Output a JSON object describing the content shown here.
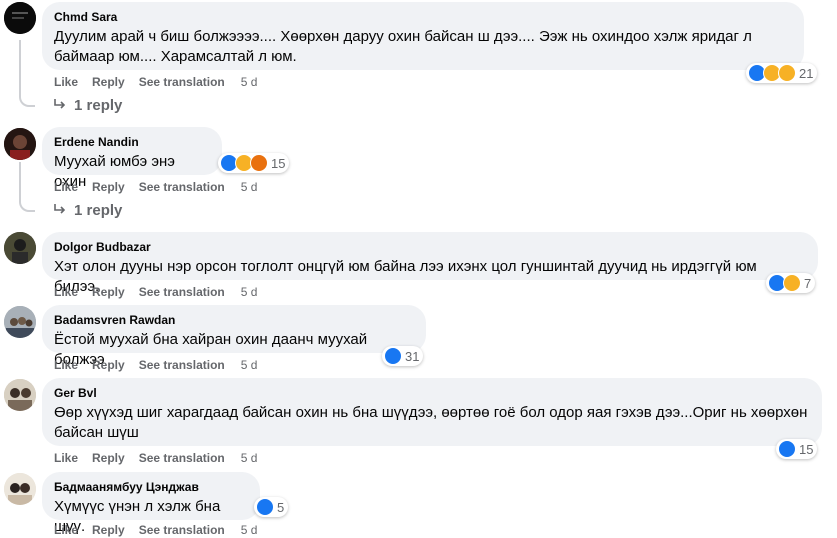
{
  "actions": {
    "like": "Like",
    "reply": "Reply",
    "see_translation": "See translation"
  },
  "comments": [
    {
      "author": "Chmd Sara",
      "text": "Дуулим арай ч биш болжээээ.... Хөөрхөн даруу охин байсан ш дээ.... Ээж нь охиндоо хэлж яридаг л баймаар юм.... Харамсалтай л юм.",
      "time": "5 d",
      "reaction_count": "21",
      "reply_label": "1 reply"
    },
    {
      "author": "Erdene Nandin",
      "text": "Муухай юмбэ энэ охин",
      "time": "5 d",
      "reaction_count": "15",
      "reply_label": "1 reply"
    },
    {
      "author": "Dolgor Budbazar",
      "text": "Хэт олон дууны нэр орсон тоглолт онцгүй юм байна лээ ихэнх цол гуншинтай дуучид нь ирдэггүй юм билээ.",
      "time": "5 d",
      "reaction_count": "7"
    },
    {
      "author": "Badamsvren Rawdan",
      "text": "Ёстой муухай бна хайран охин даанч муухай болжээ",
      "time": "5 d",
      "reaction_count": "31"
    },
    {
      "author": "Ger Bvl",
      "text": "Өөр хүүхэд шиг харагдаад байсан охин нь бна шүүдээ, өөртөө гоё бол одор яая гэхэв дээ...Ориг нь хөөрхөн байсан шүш",
      "time": "5 d",
      "reaction_count": "15"
    },
    {
      "author": "Бадмаанямбуу Цэнджав",
      "text": "Хүмүүс үнэн л хэлж бна шүү.",
      "time": "5 d",
      "reaction_count": "5"
    }
  ],
  "colors": {
    "bubble": "#f0f2f5",
    "meta": "#65676b",
    "like_blue": "#1877f2",
    "emoji_yellow": "#f7b125"
  },
  "icons": [
    "reply-arrow-icon",
    "like-reaction-icon",
    "haha-reaction-icon",
    "wow-reaction-icon",
    "sad-reaction-icon",
    "angry-reaction-icon"
  ]
}
